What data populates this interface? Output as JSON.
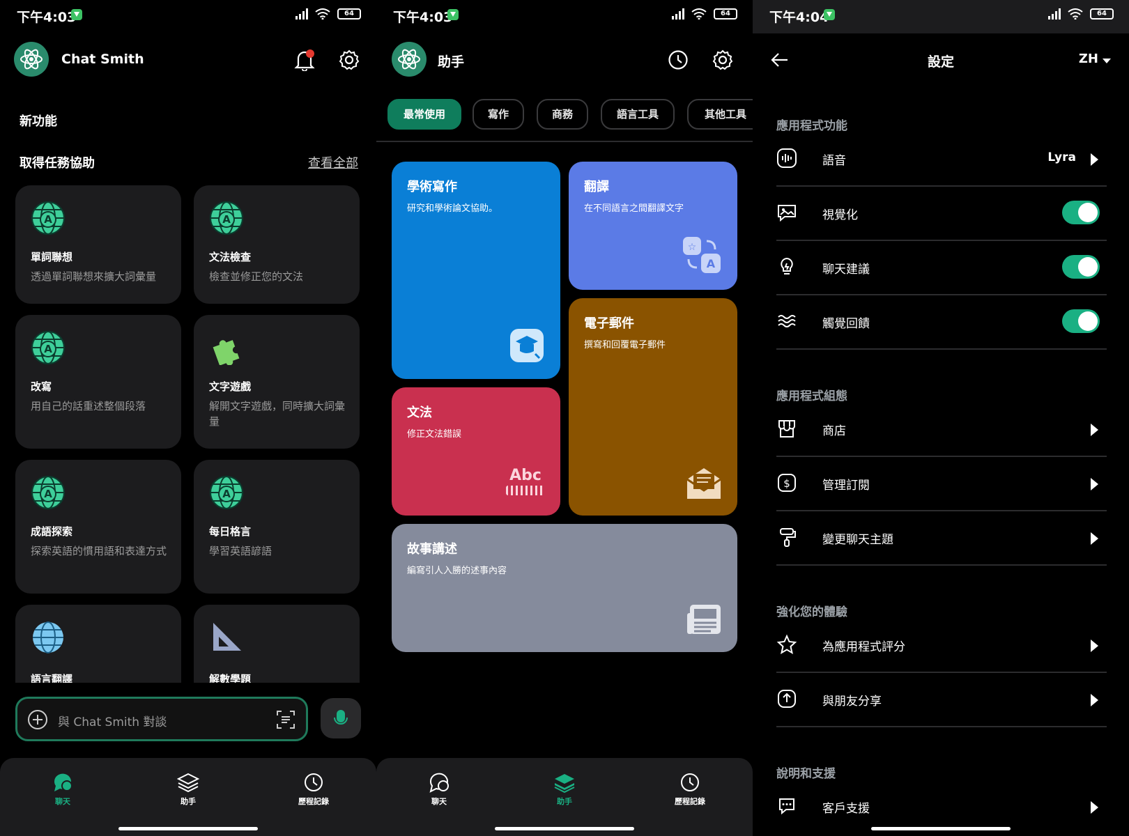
{
  "colors": {
    "accent": "#1ab083",
    "brand": "#0f7d5c",
    "tile_blue": "#0a7fd6",
    "tile_indigo": "#5b7be6",
    "tile_red": "#c9304f",
    "tile_brown": "#8a5300",
    "tile_gray": "#858b9c"
  },
  "status": {
    "s1_time": "下午4:03",
    "s2_time": "下午4:03",
    "s3_time": "下午4:04",
    "battery": "64"
  },
  "chat": {
    "title": "Chat Smith",
    "new_features": "新功能",
    "get_help": "取得任務協助",
    "see_all": "查看全部",
    "cards": [
      {
        "title": "單詞聯想",
        "desc": "透過單詞聯想來擴大詞彙量",
        "icon": "globe-a-icon"
      },
      {
        "title": "文法檢查",
        "desc": "檢查並修正您的文法",
        "icon": "globe-a-icon"
      },
      {
        "title": "改寫",
        "desc": "用自己的話重述整個段落",
        "icon": "globe-a-icon"
      },
      {
        "title": "文字遊戲",
        "desc": "解開文字遊戲，同時擴大詞彙量",
        "icon": "puzzle-icon"
      },
      {
        "title": "成語探索",
        "desc": "探索英語的慣用語和表達方式",
        "icon": "globe-a-icon"
      },
      {
        "title": "每日格言",
        "desc": "學習英語諺語",
        "icon": "globe-a-icon"
      },
      {
        "title": "語言翻譯",
        "desc": "",
        "icon": "globe-icon"
      },
      {
        "title": "解數學題",
        "desc": "",
        "icon": "set-square-icon"
      }
    ],
    "composer_placeholder": "與 Chat Smith 對談"
  },
  "nav": {
    "chat": "聊天",
    "assistant": "助手",
    "history": "歷程記錄"
  },
  "assistant": {
    "title": "助手",
    "chips": [
      "最常使用",
      "寫作",
      "商務",
      "語言工具",
      "其他工具"
    ],
    "tiles": [
      {
        "title": "學術寫作",
        "desc": "研究和學術論文協助。",
        "icon": "graduation-cap-icon"
      },
      {
        "title": "翻譯",
        "desc": "在不同語言之間翻譯文字",
        "icon": "translate-icon"
      },
      {
        "title": "文法",
        "desc": "修正文法錯誤",
        "icon": "abc-ruler-icon",
        "icon_text": "Abc"
      },
      {
        "title": "電子郵件",
        "desc": "撰寫和回覆電子郵件",
        "icon": "open-envelope-icon"
      },
      {
        "title": "故事講述",
        "desc": "編寫引人入勝的述事內容",
        "icon": "newspaper-icon"
      }
    ]
  },
  "settings": {
    "title": "設定",
    "lang": "ZH",
    "sections": [
      "應用程式功能",
      "應用程式組態",
      "強化您的體驗",
      "說明和支援"
    ],
    "voice": {
      "label": "語音",
      "value": "Lyra"
    },
    "visual": {
      "label": "視覺化",
      "on": true
    },
    "suggest": {
      "label": "聊天建議",
      "on": true
    },
    "haptic": {
      "label": "觸覺回饋",
      "on": true
    },
    "store": "商店",
    "subs": "管理訂閱",
    "theme": "變更聊天主題",
    "rate": "為應用程式評分",
    "share": "與朋友分享",
    "support": "客戶支援"
  }
}
